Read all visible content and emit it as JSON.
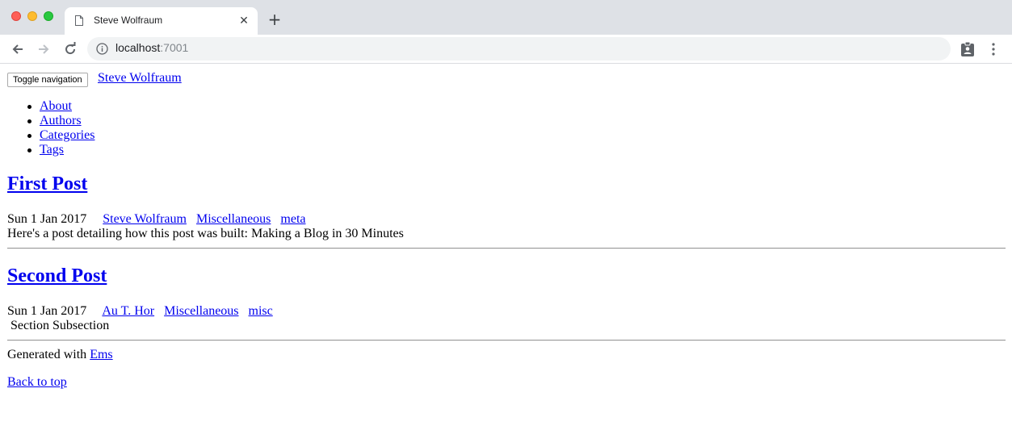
{
  "browser": {
    "tab_title": "Steve Wolfraum",
    "url_host": "localhost",
    "url_port": ":7001"
  },
  "header": {
    "toggle_label": "Toggle navigation",
    "brand": "Steve Wolfraum"
  },
  "nav": {
    "items": [
      {
        "label": "About"
      },
      {
        "label": "Authors"
      },
      {
        "label": "Categories"
      },
      {
        "label": "Tags"
      }
    ]
  },
  "posts": [
    {
      "title": "First Post",
      "date": "Sun 1 Jan 2017",
      "author": "Steve Wolfraum",
      "category": "Miscellaneous",
      "tag": "meta",
      "excerpt": "Here's a post detailing how this post was built: Making a Blog in 30 Minutes"
    },
    {
      "title": "Second Post",
      "date": "Sun 1 Jan 2017",
      "author": "Au T. Hor",
      "category": "Miscellaneous",
      "tag": "misc",
      "excerpt": " Section Subsection"
    }
  ],
  "footer": {
    "generated_prefix": "Generated with ",
    "generator_link": "Ems",
    "back_to_top": "Back to top"
  }
}
